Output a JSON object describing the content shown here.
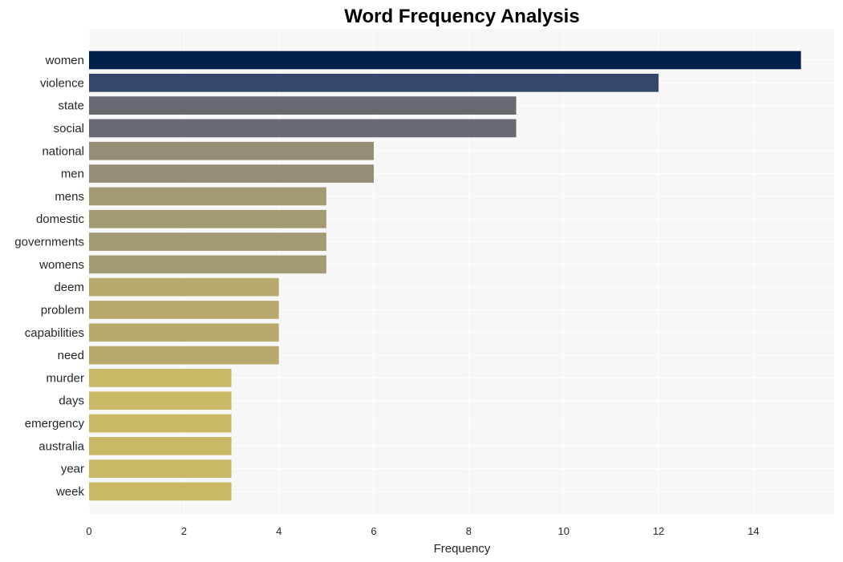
{
  "chart_data": {
    "type": "bar",
    "orientation": "horizontal",
    "title": "Word Frequency Analysis",
    "xlabel": "Frequency",
    "ylabel": "",
    "xlim": [
      0,
      15.7
    ],
    "xticks": [
      0,
      2,
      4,
      6,
      8,
      10,
      12,
      14
    ],
    "grid": true,
    "categories": [
      "women",
      "violence",
      "state",
      "social",
      "national",
      "men",
      "mens",
      "domestic",
      "governments",
      "womens",
      "deem",
      "problem",
      "capabilities",
      "need",
      "murder",
      "days",
      "emergency",
      "australia",
      "year",
      "week"
    ],
    "values": [
      15,
      12,
      9,
      9,
      6,
      6,
      5,
      5,
      5,
      5,
      4,
      4,
      4,
      4,
      3,
      3,
      3,
      3,
      3,
      3
    ],
    "colors": [
      "#00204c",
      "#37466c",
      "#676a70",
      "#676a70",
      "#958e77",
      "#958e77",
      "#a39a74",
      "#a39a74",
      "#a39a74",
      "#a39a74",
      "#b8a96c",
      "#b8a96c",
      "#b8a96c",
      "#b8a96c",
      "#c9b866",
      "#c9b866",
      "#c9b866",
      "#c9b866",
      "#c9b866",
      "#c9b866"
    ],
    "plot_background": "#f7f7f7"
  }
}
